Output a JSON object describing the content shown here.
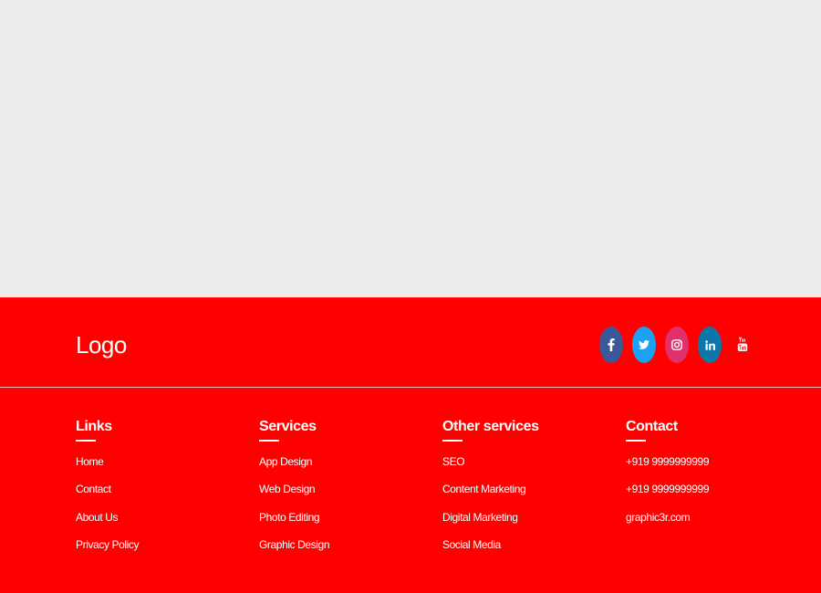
{
  "footer": {
    "logo": "Logo",
    "socials": [
      {
        "name": "facebook",
        "icon": "facebook-icon",
        "color": "#3b5998"
      },
      {
        "name": "twitter",
        "icon": "twitter-icon",
        "color": "#1da1f2"
      },
      {
        "name": "instagram",
        "icon": "instagram-icon",
        "color": "#e1306c"
      },
      {
        "name": "linkedin",
        "icon": "linkedin-icon",
        "color": "#0e76a8"
      },
      {
        "name": "youtube",
        "icon": "youtube-icon",
        "color": "#ff0000"
      }
    ],
    "background_color": "#ff0000",
    "columns": [
      {
        "title": "Links",
        "items": [
          "Home",
          "Contact",
          "About Us",
          "Privacy Policy"
        ]
      },
      {
        "title": "Services",
        "items": [
          "App Design",
          "Web Design",
          "Photo Editing",
          "Graphic Design"
        ]
      },
      {
        "title": "Other services",
        "items": [
          "SEO",
          "Content Marketing",
          "Digital Marketing",
          "Social Media"
        ]
      },
      {
        "title": "Contact",
        "items": [
          "+919 9999999999",
          "+919 9999999999",
          "graphic3r.com"
        ]
      }
    ]
  }
}
